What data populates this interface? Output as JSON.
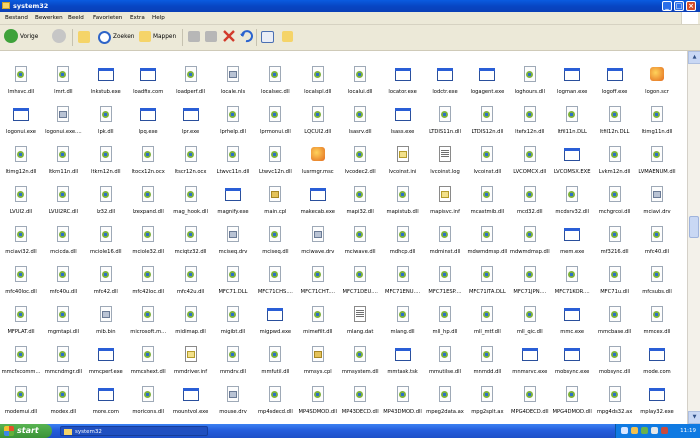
{
  "window": {
    "title": "system32"
  },
  "menu": [
    "Bestand",
    "Bewerken",
    "Beeld",
    "Favorieten",
    "Extra",
    "Help"
  ],
  "toolbar": {
    "back": "Vorige",
    "search": "Zoeken",
    "folders": "Mappen"
  },
  "files": [
    {
      "name": "lmhsvc.dll",
      "icon": "dll-file-icon"
    },
    {
      "name": "lmrt.dll",
      "icon": "dll-file-icon"
    },
    {
      "name": "lnkstub.exe",
      "icon": "exe-file-icon"
    },
    {
      "name": "loadfix.com",
      "icon": "exe-file-icon"
    },
    {
      "name": "loadperf.dll",
      "icon": "dll-file-icon"
    },
    {
      "name": "locale.nls",
      "icon": "system-file-icon"
    },
    {
      "name": "localsec.dll",
      "icon": "dll-file-icon"
    },
    {
      "name": "localspl.dll",
      "icon": "dll-file-icon"
    },
    {
      "name": "localui.dll",
      "icon": "dll-file-icon"
    },
    {
      "name": "locator.exe",
      "icon": "exe-file-icon"
    },
    {
      "name": "lodctr.exe",
      "icon": "exe-file-icon"
    },
    {
      "name": "logagent.exe",
      "icon": "exe-file-icon"
    },
    {
      "name": "loghours.dll",
      "icon": "dll-file-icon"
    },
    {
      "name": "logman.exe",
      "icon": "exe-file-icon"
    },
    {
      "name": "logoff.exe",
      "icon": "exe-file-icon"
    },
    {
      "name": "logon.scr",
      "icon": "screensaver-icon"
    },
    {
      "name": "logonui.exe",
      "icon": "exe-file-icon"
    },
    {
      "name": "logonui.exe....",
      "icon": "system-file-icon"
    },
    {
      "name": "lpk.dll",
      "icon": "dll-file-icon"
    },
    {
      "name": "lpq.exe",
      "icon": "exe-file-icon"
    },
    {
      "name": "lpr.exe",
      "icon": "exe-file-icon"
    },
    {
      "name": "lprhelp.dll",
      "icon": "dll-file-icon"
    },
    {
      "name": "lprmonui.dll",
      "icon": "dll-file-icon"
    },
    {
      "name": "LQCUI2.dll",
      "icon": "dll-file-icon"
    },
    {
      "name": "lsasrv.dll",
      "icon": "dll-file-icon"
    },
    {
      "name": "lsass.exe",
      "icon": "exe-file-icon"
    },
    {
      "name": "LTDIS11n.dll",
      "icon": "dll-file-icon"
    },
    {
      "name": "LTDIS12n.dll",
      "icon": "dll-file-icon"
    },
    {
      "name": "ltefx12n.dll",
      "icon": "dll-file-icon"
    },
    {
      "name": "ltfil11n.DLL",
      "icon": "dll-file-icon"
    },
    {
      "name": "ltfil12n.DLL",
      "icon": "dll-file-icon"
    },
    {
      "name": "ltimg11n.dll",
      "icon": "dll-file-icon"
    },
    {
      "name": "ltimg12n.dll",
      "icon": "dll-file-icon"
    },
    {
      "name": "ltkrn11n.dll",
      "icon": "dll-file-icon"
    },
    {
      "name": "ltkrn12n.dll",
      "icon": "dll-file-icon"
    },
    {
      "name": "ltocx12n.ocx",
      "icon": "dll-file-icon"
    },
    {
      "name": "ltscr12n.ocx",
      "icon": "dll-file-icon"
    },
    {
      "name": "Ltwvc11n.dll",
      "icon": "dll-file-icon"
    },
    {
      "name": "Ltwvc12n.dll",
      "icon": "dll-file-icon"
    },
    {
      "name": "lusrmgr.msc",
      "icon": "console-icon"
    },
    {
      "name": "lvcodec2.dll",
      "icon": "dll-file-icon"
    },
    {
      "name": "lvcoinst.ini",
      "icon": "ini-file-icon"
    },
    {
      "name": "lvcoinst.log",
      "icon": "text-file-icon"
    },
    {
      "name": "lvcoinst.dll",
      "icon": "dll-file-icon"
    },
    {
      "name": "LVCOMCX.dll",
      "icon": "dll-file-icon"
    },
    {
      "name": "LVCOMSX.EXE",
      "icon": "exe-file-icon"
    },
    {
      "name": "Lvkm12n.dll",
      "icon": "dll-file-icon"
    },
    {
      "name": "LVMAENUM.dll",
      "icon": "dll-file-icon"
    },
    {
      "name": "LVUI2.dll",
      "icon": "dll-file-icon"
    },
    {
      "name": "LVUI2RC.dll",
      "icon": "dll-file-icon"
    },
    {
      "name": "lz32.dll",
      "icon": "dll-file-icon"
    },
    {
      "name": "lzexpand.dll",
      "icon": "dll-file-icon"
    },
    {
      "name": "mag_hook.dll",
      "icon": "dll-file-icon"
    },
    {
      "name": "magnify.exe",
      "icon": "exe-file-icon"
    },
    {
      "name": "main.cpl",
      "icon": "control-panel-icon"
    },
    {
      "name": "makecab.exe",
      "icon": "exe-file-icon"
    },
    {
      "name": "mapi32.dll",
      "icon": "dll-file-icon"
    },
    {
      "name": "mapistub.dll",
      "icon": "dll-file-icon"
    },
    {
      "name": "mapisvc.inf",
      "icon": "ini-file-icon"
    },
    {
      "name": "mcastmib.dll",
      "icon": "dll-file-icon"
    },
    {
      "name": "mcd32.dll",
      "icon": "dll-file-icon"
    },
    {
      "name": "mcdsrv32.dll",
      "icon": "dll-file-icon"
    },
    {
      "name": "mchgrcoi.dll",
      "icon": "dll-file-icon"
    },
    {
      "name": "mciavi.drv",
      "icon": "system-file-icon"
    },
    {
      "name": "mciavi32.dll",
      "icon": "dll-file-icon"
    },
    {
      "name": "mcicda.dll",
      "icon": "dll-file-icon"
    },
    {
      "name": "mciole16.dll",
      "icon": "dll-file-icon"
    },
    {
      "name": "mciole32.dll",
      "icon": "dll-file-icon"
    },
    {
      "name": "mciqtz32.dll",
      "icon": "dll-file-icon"
    },
    {
      "name": "mciseq.drv",
      "icon": "system-file-icon"
    },
    {
      "name": "mciseq.dll",
      "icon": "dll-file-icon"
    },
    {
      "name": "mciwave.drv",
      "icon": "system-file-icon"
    },
    {
      "name": "mciwave.dll",
      "icon": "dll-file-icon"
    },
    {
      "name": "mdhcp.dll",
      "icon": "dll-file-icon"
    },
    {
      "name": "mdminst.dll",
      "icon": "dll-file-icon"
    },
    {
      "name": "mdwmdmsp.dll",
      "icon": "dll-file-icon"
    },
    {
      "name": "mdwmdmsp.dll",
      "icon": "dll-file-icon"
    },
    {
      "name": "mem.exe",
      "icon": "exe-file-icon"
    },
    {
      "name": "mf3216.dll",
      "icon": "dll-file-icon"
    },
    {
      "name": "mfc40.dll",
      "icon": "dll-file-icon"
    },
    {
      "name": "mfc40loc.dll",
      "icon": "dll-file-icon"
    },
    {
      "name": "mfc40u.dll",
      "icon": "dll-file-icon"
    },
    {
      "name": "mfc42.dll",
      "icon": "dll-file-icon"
    },
    {
      "name": "mfc42loc.dll",
      "icon": "dll-file-icon"
    },
    {
      "name": "mfc42u.dll",
      "icon": "dll-file-icon"
    },
    {
      "name": "MFC71.DLL",
      "icon": "dll-file-icon"
    },
    {
      "name": "MFC71CHS....",
      "icon": "dll-file-icon"
    },
    {
      "name": "MFC71CHT....",
      "icon": "dll-file-icon"
    },
    {
      "name": "MFC71DEU....",
      "icon": "dll-file-icon"
    },
    {
      "name": "MFC71ENU....",
      "icon": "dll-file-icon"
    },
    {
      "name": "MFC71ESP....",
      "icon": "dll-file-icon"
    },
    {
      "name": "MFC71ITA.DLL",
      "icon": "dll-file-icon"
    },
    {
      "name": "MFC71JPN....",
      "icon": "dll-file-icon"
    },
    {
      "name": "MFC71KOR....",
      "icon": "dll-file-icon"
    },
    {
      "name": "MFC71u.dll",
      "icon": "dll-file-icon"
    },
    {
      "name": "mfcsubs.dll",
      "icon": "dll-file-icon"
    },
    {
      "name": "MFPLAT.dll",
      "icon": "dll-file-icon"
    },
    {
      "name": "mgmtapi.dll",
      "icon": "dll-file-icon"
    },
    {
      "name": "mib.bin",
      "icon": "system-file-icon"
    },
    {
      "name": "microsoft.m...",
      "icon": "dll-file-icon"
    },
    {
      "name": "midimap.dll",
      "icon": "dll-file-icon"
    },
    {
      "name": "migibt.dll",
      "icon": "dll-file-icon"
    },
    {
      "name": "migpwd.exe",
      "icon": "key-exe-icon"
    },
    {
      "name": "mimefilt.dll",
      "icon": "dll-file-icon"
    },
    {
      "name": "mlang.dat",
      "icon": "text-file-icon"
    },
    {
      "name": "mlang.dll",
      "icon": "dll-file-icon"
    },
    {
      "name": "mll_hp.dll",
      "icon": "dll-file-icon"
    },
    {
      "name": "mll_mtf.dll",
      "icon": "dll-file-icon"
    },
    {
      "name": "mll_qic.dll",
      "icon": "dll-file-icon"
    },
    {
      "name": "mmc.exe",
      "icon": "tool-exe-icon"
    },
    {
      "name": "mmcbase.dll",
      "icon": "dll-file-icon"
    },
    {
      "name": "mmcex.dll",
      "icon": "dll-file-icon"
    },
    {
      "name": "mmcfxcomm...",
      "icon": "dll-file-icon"
    },
    {
      "name": "mmcndmgr.dll",
      "icon": "dll-file-icon"
    },
    {
      "name": "mmcperf.exe",
      "icon": "exe-file-icon"
    },
    {
      "name": "mmcshext.dll",
      "icon": "dll-file-icon"
    },
    {
      "name": "mmdriver.inf",
      "icon": "ini-file-icon"
    },
    {
      "name": "mmdrv.dll",
      "icon": "dll-file-icon"
    },
    {
      "name": "mmfutil.dll",
      "icon": "dll-file-icon"
    },
    {
      "name": "mmsys.cpl",
      "icon": "control-panel-icon"
    },
    {
      "name": "mmsystem.dll",
      "icon": "dll-file-icon"
    },
    {
      "name": "mmtask.tsk",
      "icon": "exe-file-icon"
    },
    {
      "name": "mmutilse.dll",
      "icon": "dll-file-icon"
    },
    {
      "name": "mnmdd.dll",
      "icon": "dll-file-icon"
    },
    {
      "name": "mnmsrvc.exe",
      "icon": "netmeeting-exe-icon"
    },
    {
      "name": "mobsync.exe",
      "icon": "sync-exe-icon"
    },
    {
      "name": "mobsync.dll",
      "icon": "dll-file-icon"
    },
    {
      "name": "mode.com",
      "icon": "exe-file-icon"
    },
    {
      "name": "modemui.dll",
      "icon": "dll-file-icon"
    },
    {
      "name": "modex.dll",
      "icon": "dll-file-icon"
    },
    {
      "name": "more.com",
      "icon": "exe-file-icon"
    },
    {
      "name": "moricons.dll",
      "icon": "dll-file-icon"
    },
    {
      "name": "mountvol.exe",
      "icon": "exe-file-icon"
    },
    {
      "name": "mouse.drv",
      "icon": "system-file-icon"
    },
    {
      "name": "mp4sdecd.dll",
      "icon": "dll-file-icon"
    },
    {
      "name": "MP4SDMOD.dll",
      "icon": "dll-file-icon"
    },
    {
      "name": "MP43DECD.dll",
      "icon": "dll-file-icon"
    },
    {
      "name": "MP43DMOD.dll",
      "icon": "dll-file-icon"
    },
    {
      "name": "mpeg2data.ax",
      "icon": "dll-file-icon"
    },
    {
      "name": "mpg2splt.ax",
      "icon": "dll-file-icon"
    },
    {
      "name": "MPG4DECD.dll",
      "icon": "dll-file-icon"
    },
    {
      "name": "MPG4DMOD.dll",
      "icon": "dll-file-icon"
    },
    {
      "name": "mpg4ds32.ax",
      "icon": "dll-file-icon"
    },
    {
      "name": "mplay32.exe",
      "icon": "mediaplayer-exe-icon"
    }
  ],
  "taskbar": {
    "start": "start",
    "window": "system32",
    "clock": "11:19"
  },
  "colors": {
    "titlebar": "#0a5ce0",
    "taskbar": "#245ddc",
    "start": "#3b9337"
  }
}
